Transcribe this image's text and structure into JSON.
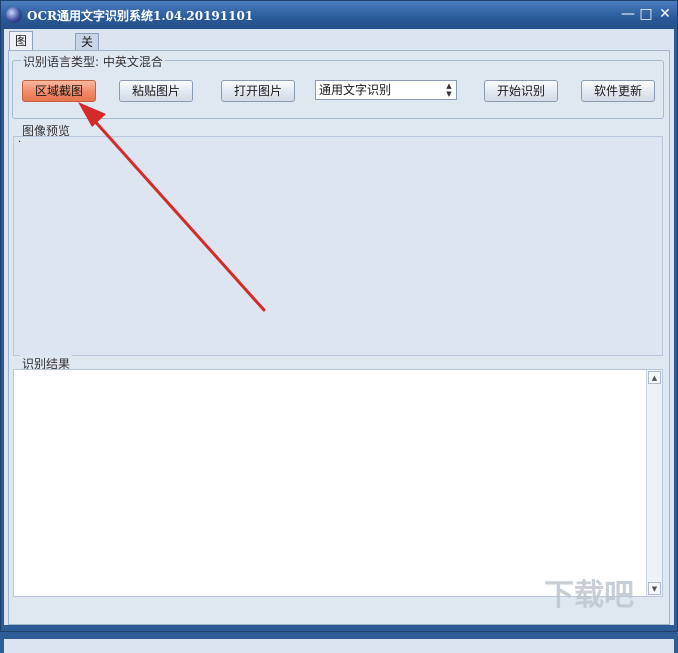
{
  "window": {
    "title": "OCR通用文字识别系统1.04.20191101",
    "minimize_label": "—",
    "maximize_label": "□",
    "close_label": "✕"
  },
  "tabs": [
    {
      "label": "图像识别",
      "active": true
    },
    {
      "label": "关于",
      "active": false
    }
  ],
  "language_group": {
    "label": "识别语言类型: 中英文混合"
  },
  "toolbar": {
    "area_capture": "区域截图",
    "paste_image": "粘贴图片",
    "open_image": "打开图片",
    "mode_select": {
      "value": "通用文字识别"
    },
    "start_recognition": "开始识别",
    "software_update": "软件更新"
  },
  "preview": {
    "label": "图像预览",
    "content": "·"
  },
  "result": {
    "label": "识别结果",
    "content": ""
  },
  "watermark": {
    "text": "下载吧"
  },
  "colors": {
    "accent_button": "#f08a68",
    "arrow": "#d42a2a",
    "title_bar": "#2a5a98"
  }
}
